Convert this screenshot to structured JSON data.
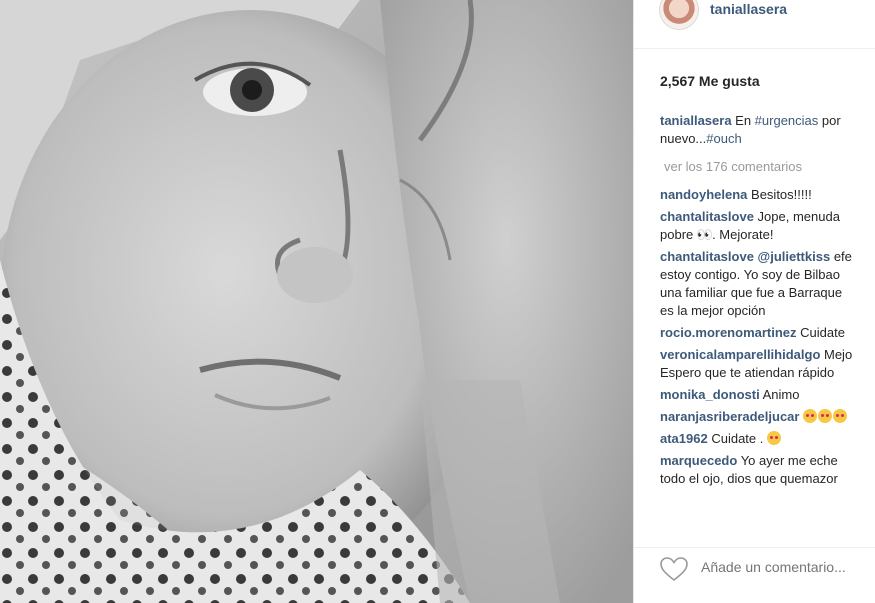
{
  "post": {
    "username": "taniallasera",
    "likes": "2,567 Me gusta",
    "caption": {
      "user": "taniallasera",
      "text_before": " En ",
      "hashtag1": "#urgencias",
      "text_after": " por",
      "line2_text": "nuevo...",
      "hashtag2": "#ouch"
    },
    "view_all": "ver los 176 comentarios",
    "comments": [
      {
        "user": "nandoyhelena",
        "text": " Besitos!!!!!"
      },
      {
        "user": "chantalitaslove",
        "text": " Jope, menuda",
        "line2": "pobre ",
        "eyes": "👀",
        "line2_after": ". Mejorate!"
      },
      {
        "user": "chantalitaslove",
        "mention": " @juliettkiss",
        "text": " efe",
        "line2": "estoy contigo. Yo soy de Bilbao",
        "line3": "una familiar que fue a Barraque",
        "line4": "es la mejor opción"
      },
      {
        "user": "rocio.morenomartinez",
        "text": " Cuidate"
      },
      {
        "user": "veronicalamparellihidalgo",
        "text": " Mejo",
        "line2": "Espero que te atiendan rápido"
      },
      {
        "user": "monika_donosti",
        "text": " Animo"
      },
      {
        "user": "naranjasriberadeljucar",
        "text": " "
      },
      {
        "user": "ata1962",
        "text": " Cuidate ."
      },
      {
        "user": "marquecedo",
        "text": " Yo ayer me eche",
        "line2": "todo el ojo, dios que quemazor"
      }
    ],
    "add_comment_placeholder": "Añade un comentario...",
    "icons": {
      "like": "heart-outline-icon"
    },
    "colors": {
      "link": "#3d5a7a",
      "muted": "#999999"
    }
  }
}
